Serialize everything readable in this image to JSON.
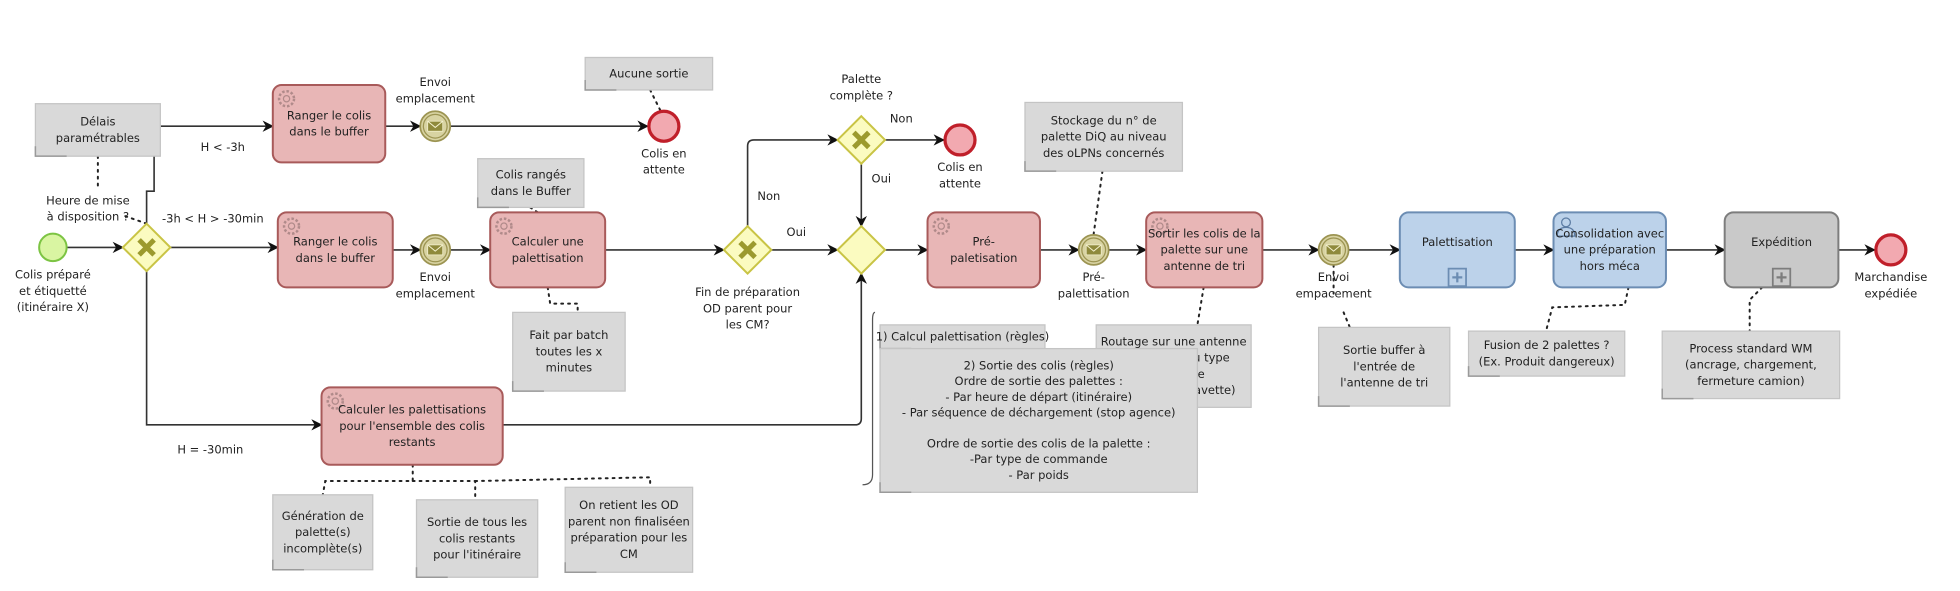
{
  "colors": {
    "task_fill": "#e8b6b6",
    "task_stroke": "#a85a5a",
    "subprocess_blue_fill": "#bcd2ea",
    "subprocess_blue_stroke": "#6c8db3",
    "subprocess_gray_fill": "#c9c9c9",
    "subprocess_gray_stroke": "#7d7d7d",
    "gateway_fill": "#fbfbc0",
    "gateway_stroke": "#c9c445",
    "gateway_mark": "#9c9a2e",
    "start_fill": "#d9f5a2",
    "start_stroke": "#7cc443",
    "end_fill": "#f2a9b0",
    "end_stroke": "#c01f2a",
    "message_fill": "#d8d3a2",
    "message_stroke": "#9c9452",
    "annotation_fill": "#d9d9d9"
  },
  "events": [
    {
      "id": "start",
      "type": "start",
      "label": [
        "Colis préparé",
        "et étiquetté",
        "(itinéraire X)"
      ]
    },
    {
      "id": "msg1",
      "type": "message",
      "icon": "envelope-icon",
      "label": [
        "Envoi",
        "emplacement"
      ]
    },
    {
      "id": "end1",
      "type": "end",
      "label": [
        "Colis en",
        "attente"
      ]
    },
    {
      "id": "msg2",
      "type": "message",
      "icon": "envelope-icon",
      "label": [
        "Envoi",
        "emplacement"
      ]
    },
    {
      "id": "end2",
      "type": "end",
      "label": [
        "Colis en",
        "attente"
      ]
    },
    {
      "id": "msg3",
      "type": "message",
      "icon": "envelope-icon",
      "label": [
        "Pré-",
        "palettisation"
      ]
    },
    {
      "id": "msg4",
      "type": "message",
      "icon": "envelope-icon",
      "label": [
        "Envoi",
        "empacement"
      ]
    },
    {
      "id": "end3",
      "type": "end",
      "label": [
        "Marchandise",
        "expédiée"
      ]
    }
  ],
  "gateways": [
    {
      "id": "gw1",
      "kind": "exclusive",
      "label": [
        "Heure de mise",
        "à disposition ?"
      ]
    },
    {
      "id": "gw2",
      "kind": "exclusive",
      "label": [
        "Fin de préparation",
        "OD parent pour",
        "les CM?"
      ]
    },
    {
      "id": "gw3",
      "kind": "exclusive",
      "label": [
        "Palette",
        "complète ?"
      ]
    },
    {
      "id": "gw4",
      "kind": "merge",
      "label": []
    }
  ],
  "tasks": [
    {
      "id": "t1",
      "kind": "service",
      "label": [
        "Ranger le colis",
        "dans le buffer"
      ]
    },
    {
      "id": "t2",
      "kind": "service",
      "label": [
        "Ranger le colis",
        "dans le buffer"
      ]
    },
    {
      "id": "t3",
      "kind": "service",
      "label": [
        "Calculer une",
        "palettisation"
      ]
    },
    {
      "id": "t4",
      "kind": "service",
      "label": [
        "Calculer les palettisations",
        "pour l'ensemble des colis",
        "restants"
      ]
    },
    {
      "id": "t5",
      "kind": "service",
      "label": [
        "Pré-",
        "paletisation"
      ]
    },
    {
      "id": "t6",
      "kind": "service",
      "label": [
        "Sortir les colis de la",
        "palette sur une",
        "antenne de tri"
      ]
    },
    {
      "id": "s1",
      "kind": "subprocess-blue",
      "label": [
        "Palettisation"
      ]
    },
    {
      "id": "s2",
      "kind": "user-blue",
      "label": [
        "Consolidation avec",
        "une préparation",
        "hors méca"
      ]
    },
    {
      "id": "s3",
      "kind": "subprocess-gray",
      "label": [
        "Expédition"
      ]
    }
  ],
  "flow_labels": [
    {
      "id": "f_h3",
      "text": "H < -3h"
    },
    {
      "id": "f_mid",
      "text": "-3h < H > -30min"
    },
    {
      "id": "f_h30",
      "text": "H = -30min"
    },
    {
      "id": "f_oui1",
      "text": "Oui"
    },
    {
      "id": "f_non1",
      "text": "Non"
    },
    {
      "id": "f_non2",
      "text": "Non"
    },
    {
      "id": "f_oui2",
      "text": "Oui"
    }
  ],
  "annotations": [
    {
      "id": "a_delais",
      "lines": [
        "Délais",
        "paramétrables"
      ]
    },
    {
      "id": "a_aucune",
      "lines": [
        "Aucune sortie"
      ]
    },
    {
      "id": "a_ranges",
      "lines": [
        "Colis rangés",
        "dans le Buffer"
      ]
    },
    {
      "id": "a_batch",
      "lines": [
        "Fait par batch",
        "toutes les x",
        "minutes"
      ]
    },
    {
      "id": "a_stockage",
      "lines": [
        "Stockage du n° de",
        "palette DiQ au niveau",
        "des oLPNs concernés"
      ]
    },
    {
      "id": "a_routage",
      "lines": [
        "Routage sur une antenne",
        "en fonction du type",
        "d'itinéraire",
        "(Messagerie/Navette)"
      ]
    },
    {
      "id": "a_regle1",
      "lines": [
        "1) Calcul palettisation (règles)"
      ]
    },
    {
      "id": "a_regle2",
      "lines": [
        "2) Sortie des colis (règles)",
        "Ordre de sortie des palettes :",
        "- Par heure de départ (itinéraire)",
        "- Par séquence de déchargement (stop agence)",
        "",
        "Ordre de sortie des colis de la palette :",
        "-Par type de commande",
        "- Par poids"
      ]
    },
    {
      "id": "a_sortie",
      "lines": [
        "Sortie buffer à",
        "l'entrée de",
        "l'antenne de tri"
      ]
    },
    {
      "id": "a_fusion",
      "lines": [
        "Fusion de 2 palettes ?",
        "(Ex. Produit dangereux)"
      ]
    },
    {
      "id": "a_process",
      "lines": [
        "Process standard WM",
        "(ancrage, chargement,",
        "fermeture camion)"
      ]
    },
    {
      "id": "a_generation",
      "lines": [
        "Génération de",
        "palette(s)",
        "incomplète(s)"
      ]
    },
    {
      "id": "a_sortie_tous",
      "lines": [
        "Sortie de tous les",
        "colis restants",
        "pour l'itinéraire"
      ]
    },
    {
      "id": "a_od",
      "lines": [
        "On retient les OD",
        "parent non finaliséen",
        "préparation pour les",
        "CM"
      ]
    }
  ]
}
